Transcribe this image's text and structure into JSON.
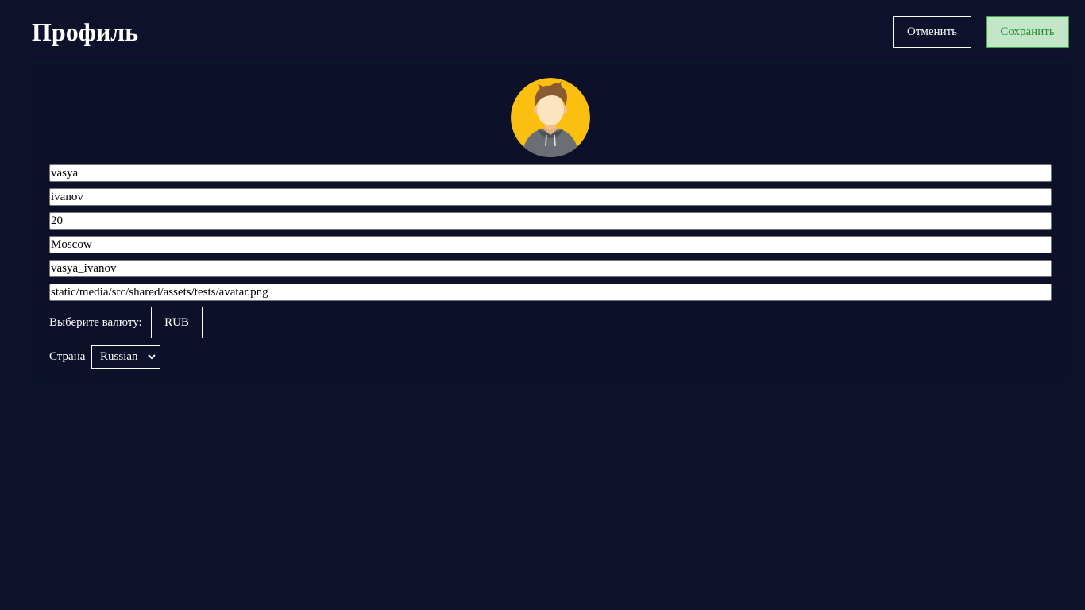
{
  "header": {
    "title": "Профиль",
    "cancel_label": "Отменить",
    "save_label": "Сохранить"
  },
  "profile": {
    "first_name": "vasya",
    "last_name": "ivanov",
    "age": "20",
    "city": "Moscow",
    "username": "vasya_ivanov",
    "avatar_path": "static/media/src/shared/assets/tests/avatar.png"
  },
  "currency": {
    "label": "Выберите валюту:",
    "value": "RUB"
  },
  "country": {
    "label": "Страна",
    "value": "Russian"
  },
  "colors": {
    "background": "#0e112b",
    "card": "#0c1129",
    "save_bg": "#c4e6c8",
    "save_text": "#2f8a35",
    "avatar_bg": "#fbbf0f"
  }
}
